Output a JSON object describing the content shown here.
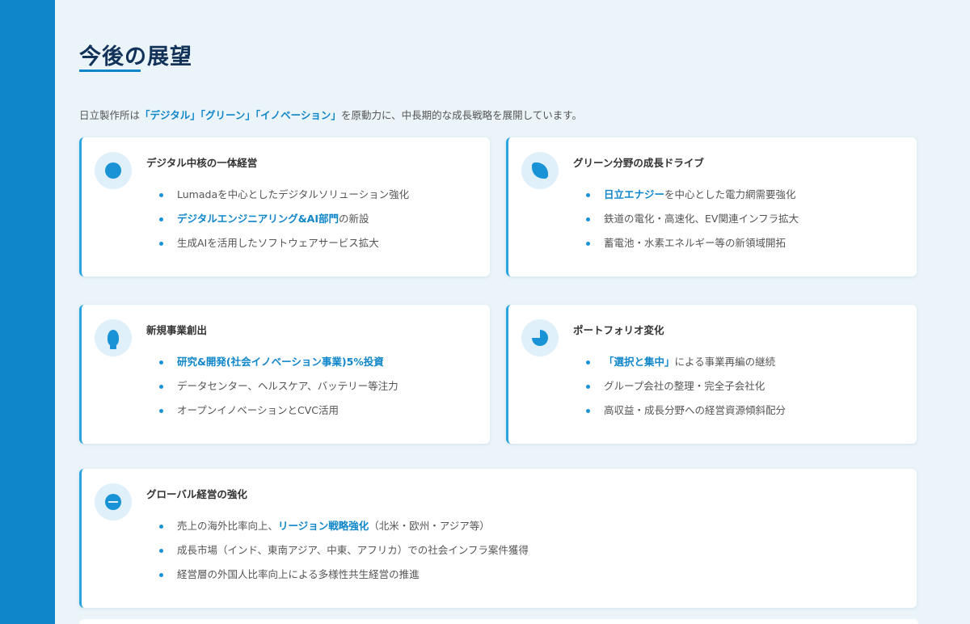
{
  "title": "今後の展望",
  "intro": {
    "prefix": "日立製作所は",
    "kw1": "「デジタル」",
    "kw2": "「グリーン」",
    "kw3": "「イノベーション」",
    "suffix": "を原動力に、中長期的な成長戦略を展開しています。"
  },
  "cards": [
    {
      "icon": "digital-icon",
      "title": "デジタル中核の一体経営",
      "items": [
        {
          "pre": "",
          "hl": "",
          "post": "Lumadaを中心としたデジタルソリューション強化"
        },
        {
          "pre": "",
          "hl": "デジタルエンジニアリング&AI部門",
          "post": "の新設"
        },
        {
          "pre": "",
          "hl": "",
          "post": "生成AIを活用したソフトウェアサービス拡大"
        }
      ]
    },
    {
      "icon": "leaf-icon",
      "title": "グリーン分野の成長ドライブ",
      "items": [
        {
          "pre": "",
          "hl": "日立エナジー",
          "post": "を中心とした電力網需要強化"
        },
        {
          "pre": "",
          "hl": "",
          "post": "鉄道の電化・高速化、EV関連インフラ拡大"
        },
        {
          "pre": "",
          "hl": "",
          "post": "蓄電池・水素エネルギー等の新領域開拓"
        }
      ]
    },
    {
      "icon": "lightbulb-icon",
      "title": "新規事業創出",
      "items": [
        {
          "pre": "",
          "hl": "研究&開発(社会イノベーション事業)5%投資",
          "post": ""
        },
        {
          "pre": "",
          "hl": "",
          "post": "データセンター、ヘルスケア、バッテリー等注力"
        },
        {
          "pre": "",
          "hl": "",
          "post": "オープンイノベーションとCVC活用"
        }
      ]
    },
    {
      "icon": "pie-chart-icon",
      "title": "ポートフォリオ変化",
      "items": [
        {
          "pre": "",
          "hl": "「選択と集中」",
          "post": "による事業再編の継続"
        },
        {
          "pre": "",
          "hl": "",
          "post": "グループ会社の整理・完全子会社化"
        },
        {
          "pre": "",
          "hl": "",
          "post": "高収益・成長分野への経営資源傾斜配分"
        }
      ]
    },
    {
      "icon": "globe-icon",
      "title": "グローバル経営の強化",
      "items": [
        {
          "pre": "売上の海外比率向上、",
          "hl": "リージョン戦略強化",
          "post": "（北米・欧州・アジア等）"
        },
        {
          "pre": "",
          "hl": "",
          "post": "成長市場（インド、東南アジア、中東、アフリカ）での社会インフラ案件獲得"
        },
        {
          "pre": "",
          "hl": "",
          "post": "経営層の外国人比率向上による多様性共生経営の推進"
        }
      ]
    }
  ],
  "colors": {
    "accent": "#0f86c9",
    "sidebar": "#0f86c9",
    "background": "#eaf4f9",
    "title": "#12325a"
  }
}
